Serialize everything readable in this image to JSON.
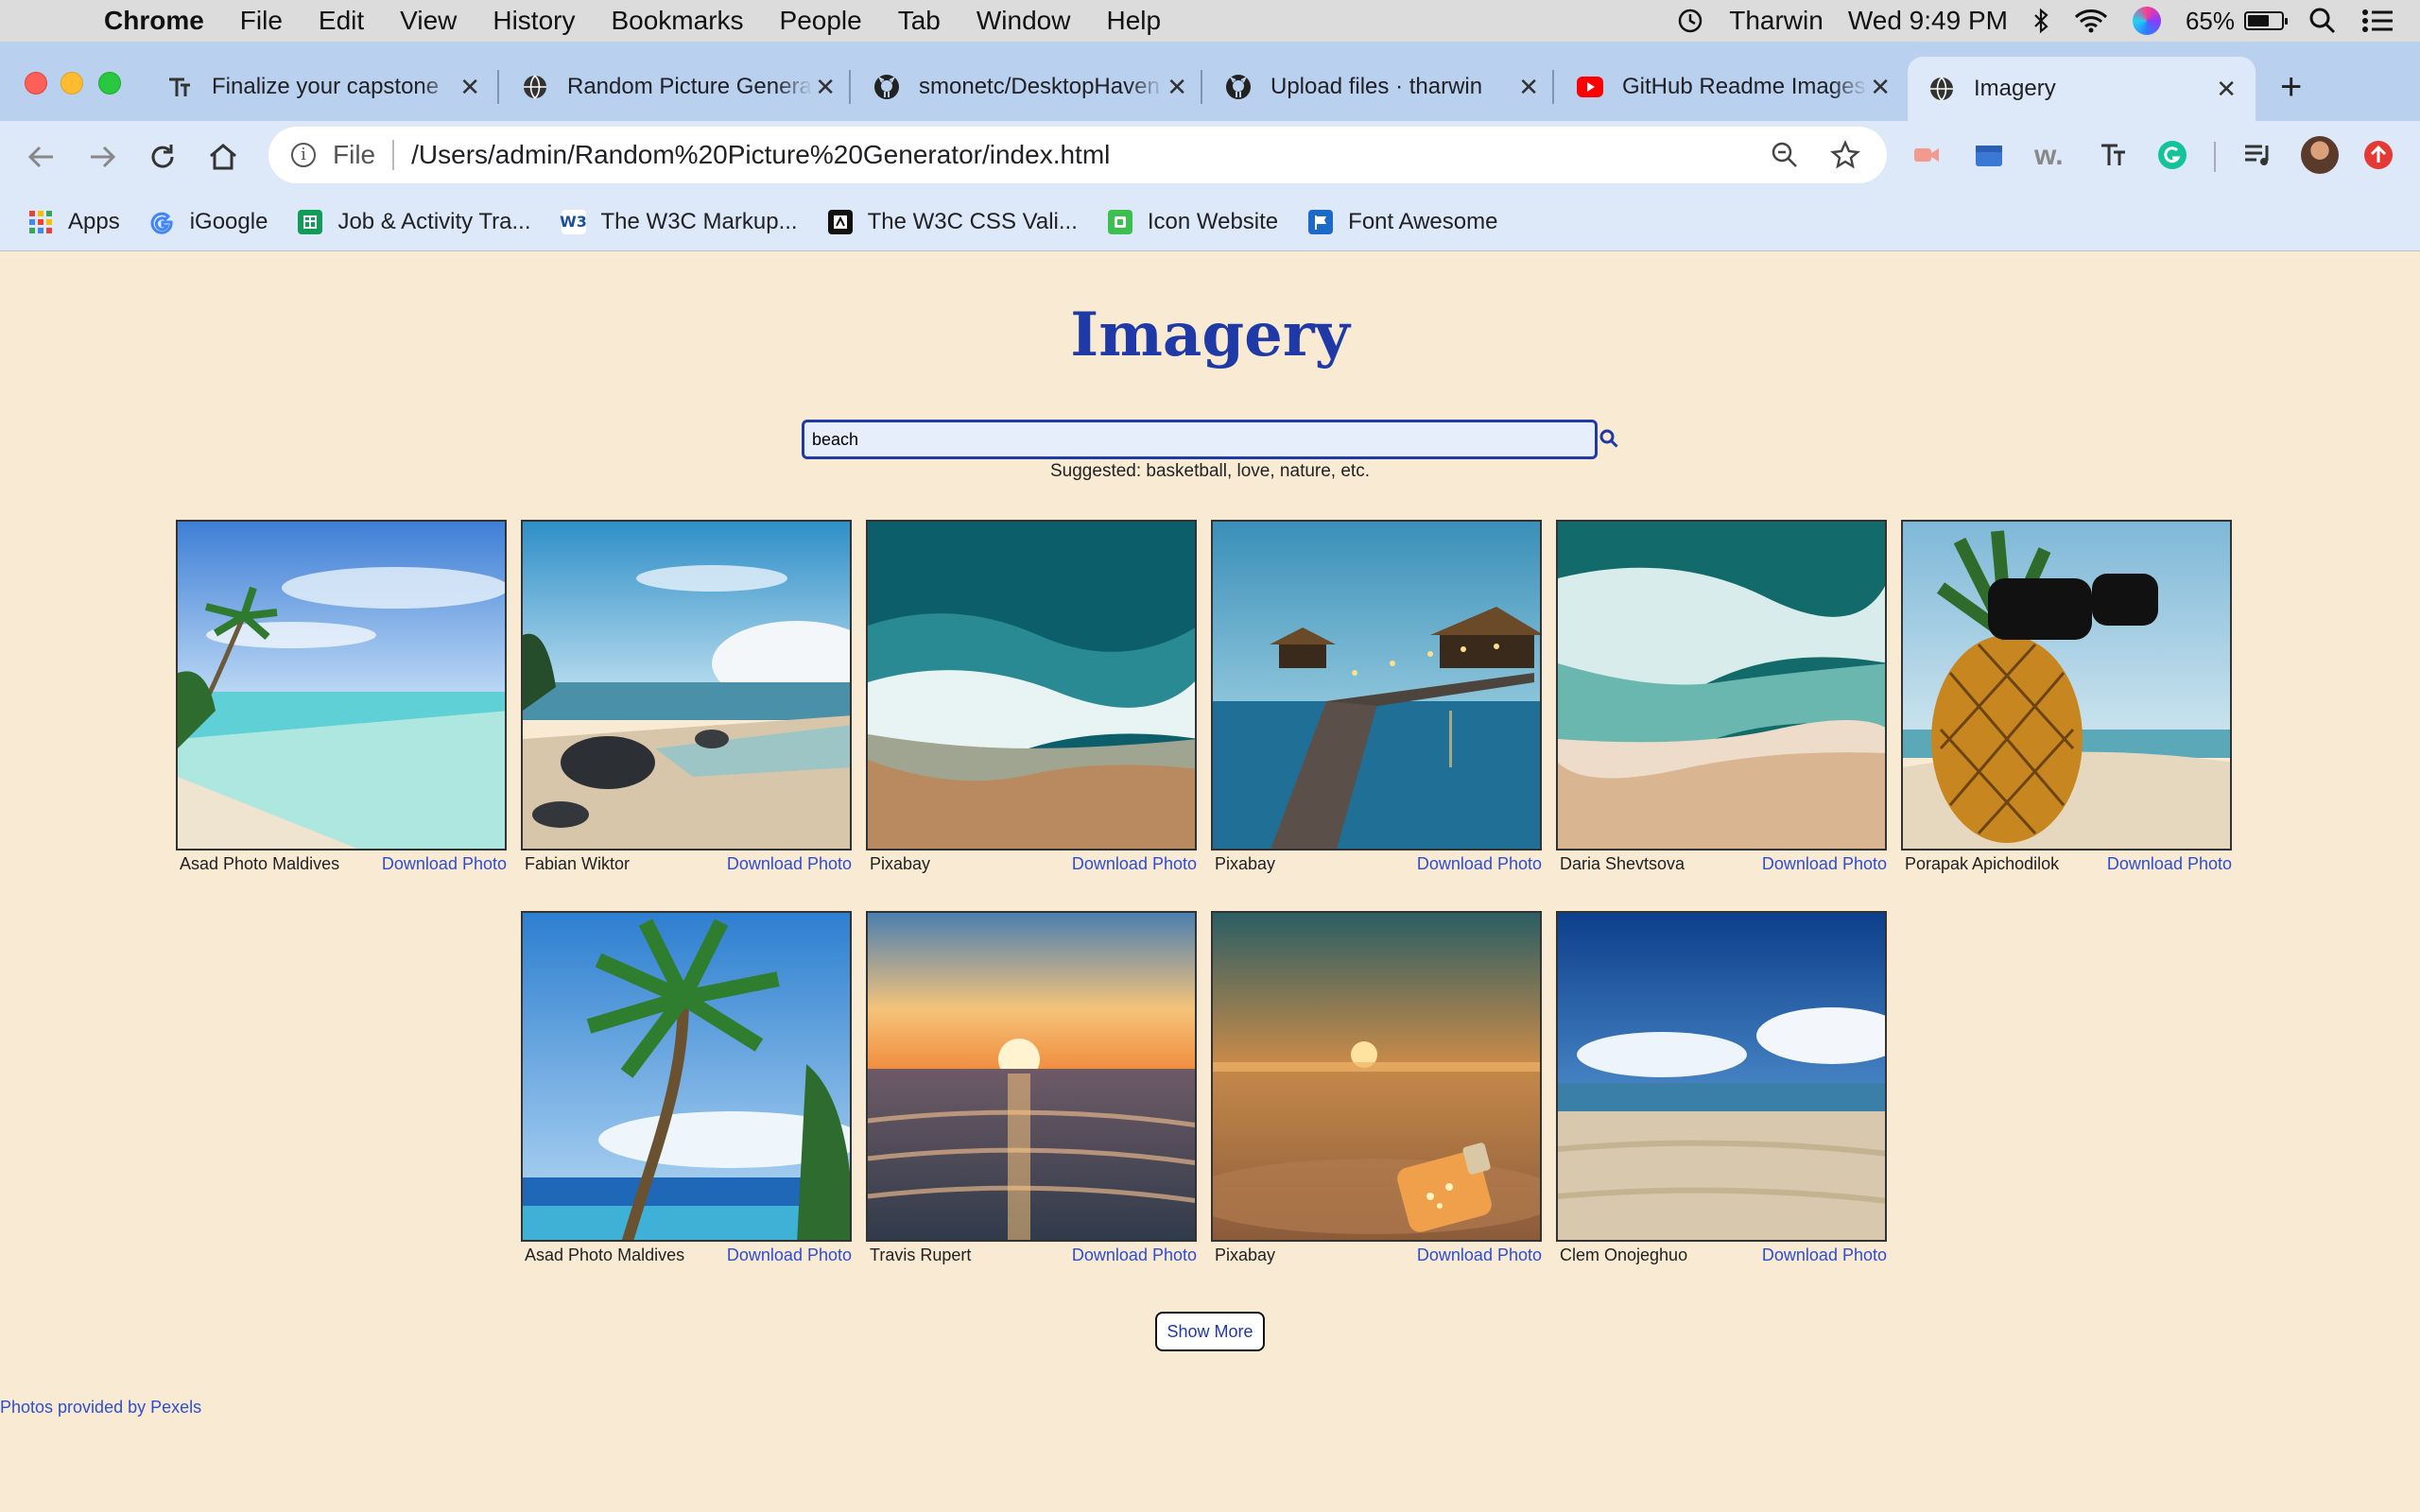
{
  "menubar": {
    "app": "Chrome",
    "items": [
      "File",
      "Edit",
      "View",
      "History",
      "Bookmarks",
      "People",
      "Tab",
      "Window",
      "Help"
    ],
    "user": "Tharwin",
    "clock": "Wed 9:49 PM",
    "battery": "65%"
  },
  "tabs": [
    {
      "title": "Finalize your capstone",
      "icon": "text-t-icon"
    },
    {
      "title": "Random Picture Generator",
      "icon": "globe-icon"
    },
    {
      "title": "smonetc/DesktopHaven",
      "icon": "github-icon"
    },
    {
      "title": "Upload files · tharwin",
      "icon": "github-icon"
    },
    {
      "title": "GitHub Readme Images",
      "icon": "youtube-icon"
    },
    {
      "title": "Imagery",
      "icon": "globe-icon",
      "active": true
    }
  ],
  "omnibox": {
    "scheme_label": "File",
    "url": "/Users/admin/Random%20Picture%20Generator/index.html"
  },
  "bookmarks": [
    {
      "label": "Apps",
      "icon": "apps-grid-icon"
    },
    {
      "label": "iGoogle",
      "icon": "google-icon"
    },
    {
      "label": "Job & Activity Tra...",
      "icon": "sheets-icon"
    },
    {
      "label": "The W3C Markup...",
      "icon": "w3c-icon"
    },
    {
      "label": "The W3C CSS Vali...",
      "icon": "w3c-css-icon"
    },
    {
      "label": "Icon Website",
      "icon": "icon-site-icon"
    },
    {
      "label": "Font Awesome",
      "icon": "flag-icon"
    }
  ],
  "page": {
    "title": "Imagery",
    "search_value": "beach",
    "suggested": "Suggested: basketball, love, nature, etc.",
    "show_more": "Show More",
    "footer": "Photos provided by Pexels",
    "download_label": "Download Photo",
    "photos": [
      {
        "author": "Asad Photo Maldives",
        "scene": "tropical-shore"
      },
      {
        "author": "Fabian Wiktor",
        "scene": "rocky-beach"
      },
      {
        "author": "Pixabay",
        "scene": "aerial-waves"
      },
      {
        "author": "Pixabay",
        "scene": "pier-dusk"
      },
      {
        "author": "Daria Shevtsova",
        "scene": "aerial-surf"
      },
      {
        "author": "Porapak Apichodilok",
        "scene": "pineapple-sunglasses"
      },
      {
        "author": "Asad Photo Maldives",
        "scene": "palm-tree"
      },
      {
        "author": "Travis Rupert",
        "scene": "sunset-sea"
      },
      {
        "author": "Pixabay",
        "scene": "bottle-sunset"
      },
      {
        "author": "Clem Onojeghuo",
        "scene": "sandy-beach"
      }
    ]
  },
  "colors": {
    "page_bg": "#f9ead4",
    "title": "#1f3aa6",
    "link": "#2d4ed1",
    "tabstrip": "#b9d0ee",
    "toolbar": "#dde8f8"
  }
}
